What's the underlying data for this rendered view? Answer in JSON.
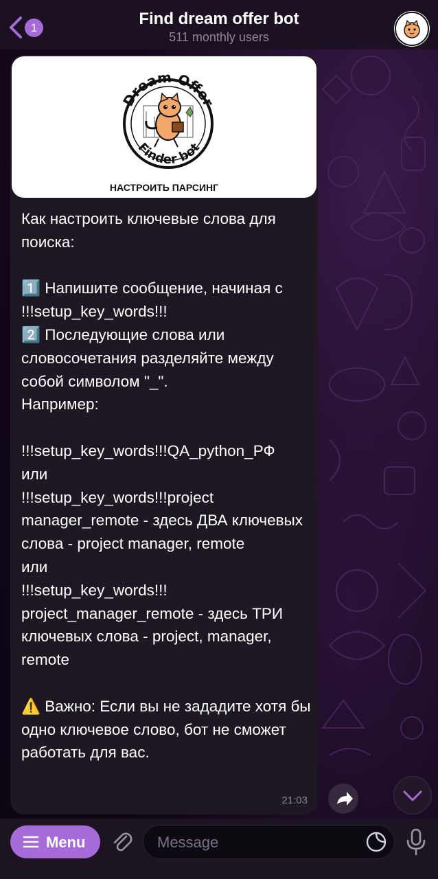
{
  "header": {
    "back_badge": "1",
    "title": "Find dream offer bot",
    "subtitle": "511 monthly users"
  },
  "message": {
    "image_logo_text_top": "Dream Offer",
    "image_logo_text_bottom": "Finder bot",
    "image_caption": "НАСТРОИТЬ ПАРСИНГ",
    "text": "Как настроить ключевые слова для поиска:\n\n1️⃣ Напишите сообщение, начиная с\n!!!setup_key_words!!!\n2️⃣ Последующие слова или словосочетания разделяйте между собой символом \"_\".\nНапример:\n\n!!!setup_key_words!!!QA_python_РФ\nили\n!!!setup_key_words!!!project manager_remote - здесь ДВА ключевых слова - project manager, remote\nили\n!!!setup_key_words!!!\nproject_manager_remote - здесь ТРИ ключевых слова - project, manager, remote\n\n⚠️ Важно: Если вы не зададите хотя бы одно ключевое слово, бот не сможет работать для вас.",
    "time": "21:03"
  },
  "input_bar": {
    "menu_label": "Menu",
    "message_placeholder": "Message"
  },
  "icons": {
    "back": "chevron-left-icon",
    "share": "share-arrow-icon",
    "scroll_down": "chevron-down-icon",
    "menu": "hamburger-icon",
    "attach": "paperclip-icon",
    "sticker": "sticker-icon",
    "mic": "microphone-icon"
  },
  "colors": {
    "accent": "#a76bd9",
    "bubble": "#1e1822",
    "header": "#1c1222"
  }
}
